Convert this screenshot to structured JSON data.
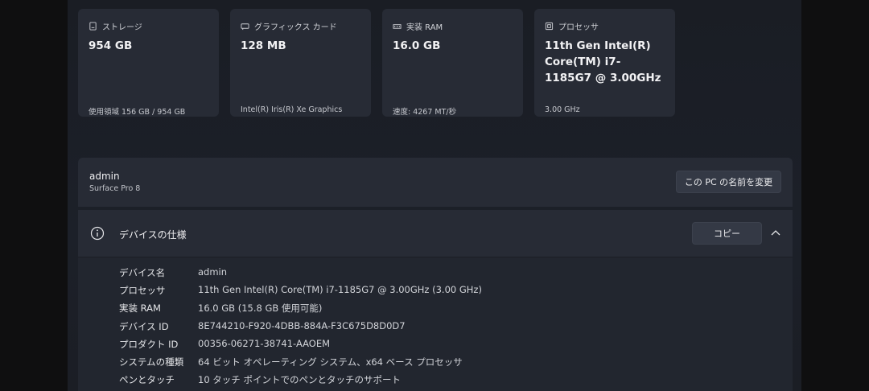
{
  "cards": [
    {
      "icon": "storage-icon",
      "label": "ストレージ",
      "value": "954 GB",
      "sub": "使用領域 156 GB / 954 GB"
    },
    {
      "icon": "graphics-card-icon",
      "label": "グラフィックス カード",
      "value": "128 MB",
      "sub": "Intel(R) Iris(R) Xe Graphics"
    },
    {
      "icon": "ram-icon",
      "label": "実装 RAM",
      "value": "16.0 GB",
      "sub": "速度: 4267 MT/秒"
    },
    {
      "icon": "processor-icon",
      "label": "プロセッサ",
      "value": "11th Gen Intel(R) Core(TM) i7-1185G7 @ 3.00GHz",
      "sub": "3.00 GHz"
    }
  ],
  "device": {
    "name": "admin",
    "model": "Surface Pro 8",
    "rename_label": "この PC の名前を変更"
  },
  "specs": {
    "title": "デバイスの仕様",
    "copy_label": "コピー",
    "rows": [
      {
        "key": "デバイス名",
        "value": "admin"
      },
      {
        "key": "プロセッサ",
        "value": "11th Gen Intel(R) Core(TM) i7-1185G7 @ 3.00GHz (3.00 GHz)"
      },
      {
        "key": "実装 RAM",
        "value": "16.0 GB (15.8 GB 使用可能)"
      },
      {
        "key": "デバイス ID",
        "value": "8E744210-F920-4DBB-884A-F3C675D8D0D7"
      },
      {
        "key": "プロダクト ID",
        "value": "00356-06271-38741-AAOEM"
      },
      {
        "key": "システムの種類",
        "value": "64 ビット オペレーティング システム、x64 ベース プロセッサ"
      },
      {
        "key": "ペンとタッチ",
        "value": "10 タッチ ポイントでのペンとタッチのサポート"
      }
    ]
  }
}
